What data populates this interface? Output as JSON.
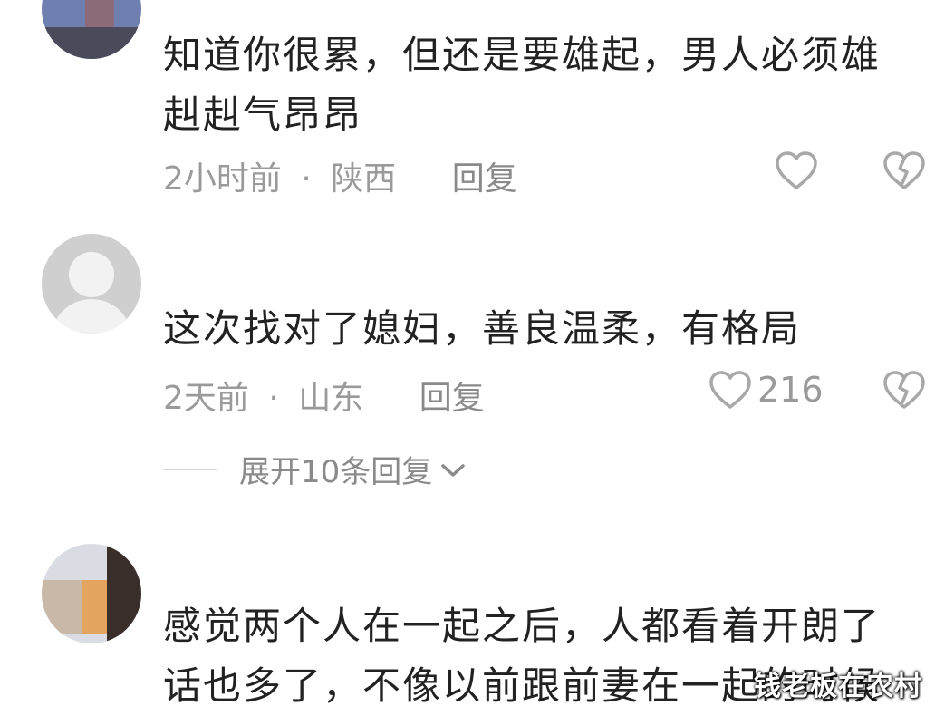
{
  "comments": [
    {
      "username": "",
      "text": "知道你很累，但还是要雄起，男人必须雄赳赳气昂昂",
      "time": "2小时前",
      "sep": "·",
      "location": "陕西",
      "reply": "回复",
      "likes": ""
    },
    {
      "username": "",
      "text": "这次找对了媳妇，善良温柔，有格局",
      "time": "2天前",
      "sep": "·",
      "location": "山东",
      "reply": "回复",
      "likes": "216",
      "expand": "展开10条回复"
    },
    {
      "username": "",
      "text": "感觉两个人在一起之后，人都看着开朗了话也多了，不像以前跟前妻在一起的时候"
    }
  ],
  "watermark": "钱老板在农村",
  "icons": {
    "like": "heart-outline-icon",
    "dislike": "broken-heart-icon",
    "expand": "chevron-down-icon"
  },
  "colors": {
    "text": "#222222",
    "meta": "#9a9a9a",
    "icon": "#a8a8a8"
  }
}
